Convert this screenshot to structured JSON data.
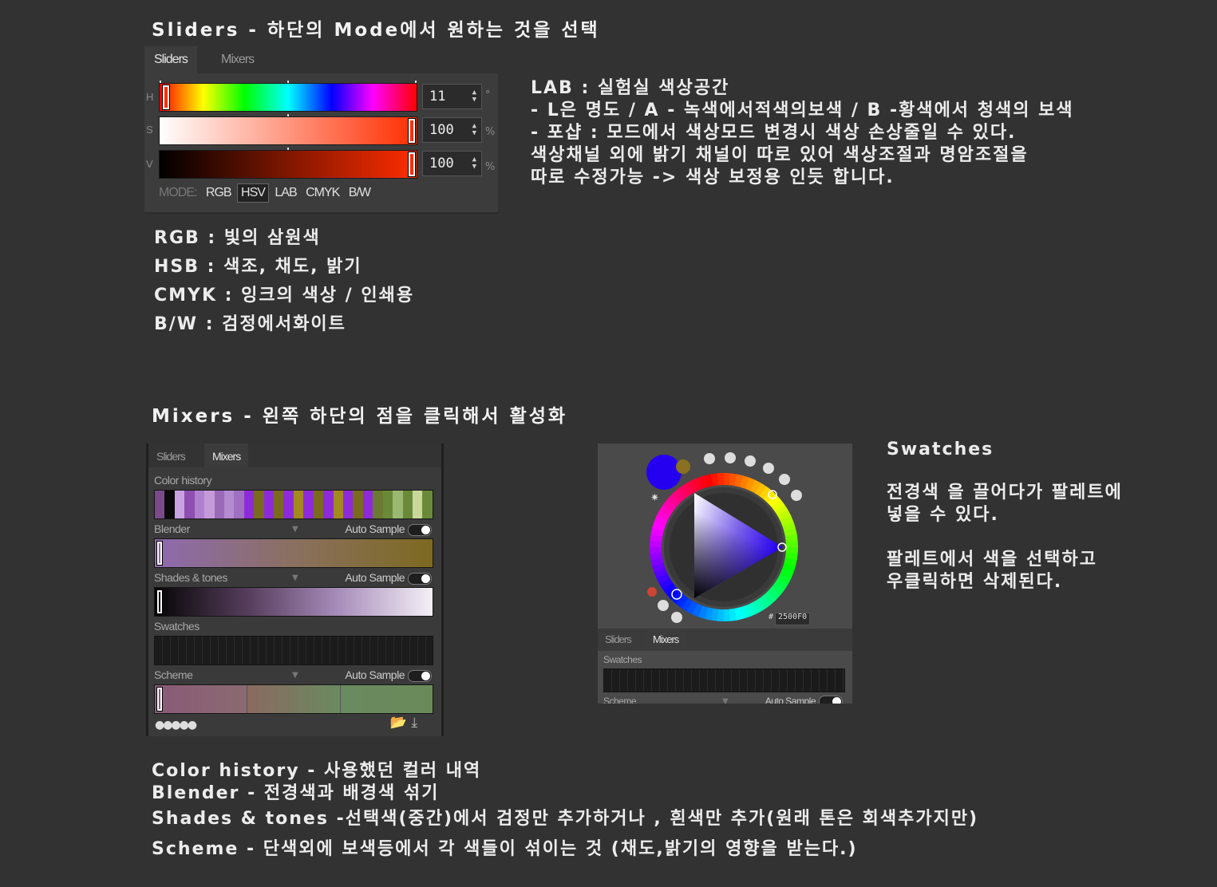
{
  "sliders_section": {
    "heading": "Sliders - 하단의 Mode에서 원하는 것을 선택",
    "panel": {
      "tabs": [
        "Sliders",
        "Mixers"
      ],
      "rows": [
        {
          "label": "H",
          "value": "11",
          "unit": "°"
        },
        {
          "label": "S",
          "value": "100",
          "unit": "%"
        },
        {
          "label": "V",
          "value": "100",
          "unit": "%"
        }
      ],
      "mode_label": "MODE:",
      "modes": [
        "RGB",
        "HSV",
        "LAB",
        "CMYK",
        "B/W"
      ],
      "selected_mode": "HSV",
      "current_color": "#ff2d00"
    },
    "lab_notes": [
      "LAB : 실험실 색상공간",
      "- L은 명도 / A - 녹색에서적색의보색 / B -황색에서 청색의 보색",
      "- 포샵 : 모드에서  색상모드 변경시 색상 손상줄일 수 있다.",
      "색상채널 외에 밝기 채널이 따로 있어 색상조절과 명암조절을",
      "따로 수정가능 -> 색상 보정용 인듯 합니다."
    ],
    "mode_notes": [
      "RGB : 빛의 삼원색",
      "HSB : 색조, 채도, 밝기",
      "CMYK : 잉크의 색상 / 인쇄용",
      "B/W : 검정에서화이트"
    ]
  },
  "mixers_section": {
    "heading": "Mixers - 왼쪽 하단의 점을 클릭해서 활성화",
    "panel": {
      "tabs": [
        "Sliders",
        "Mixers"
      ],
      "active_tab": "Mixers",
      "color_history_label": "Color history",
      "color_history": [
        "#7a4a8a",
        "#0a0a0a",
        "#c9a2e0",
        "#8e4fb0",
        "#b080d0",
        "#c59ad8",
        "#9a6ab8",
        "#b48ad0",
        "#a070c0",
        "#8e2bd8",
        "#7a6a20",
        "#8e2bd8",
        "#7a6a20",
        "#8e2bd8",
        "#a38a20",
        "#8e2bd8",
        "#7a6a20",
        "#8e2bd8",
        "#a38a20",
        "#8e2bd8",
        "#7a6a20",
        "#8e2bd8",
        "#6a7a30",
        "#6a8a3a",
        "#9ab870",
        "#6a8a3a",
        "#c9d89a",
        "#6a8a3a"
      ],
      "blender_label": "Blender",
      "shades_label": "Shades & tones",
      "swatches_label": "Swatches",
      "scheme_label": "Scheme",
      "auto_sample": "Auto Sample",
      "bottom_dots": "●●●●●"
    },
    "wheel_panel": {
      "hex_value": "2500F0",
      "hash": "#",
      "tabs": [
        "Sliders",
        "Mixers"
      ],
      "active_tab": "Mixers",
      "swatches_label": "Swatches",
      "scheme_label": "Scheme",
      "auto_sample": "Auto Sample",
      "foreground_color": "#2500f0"
    },
    "swatches_notes": {
      "title": "Swatches",
      "lines1": [
        "전경색 을 끌어다가 팔레트에",
        "넣을 수 있다."
      ],
      "lines2": [
        "팔레트에서 색을 선택하고",
        "우클릭하면 삭제된다."
      ]
    },
    "bottom_notes": [
      "Color history - 사용했던 컬러 내역",
      "Blender - 전경색과 배경색 섞기",
      "Shades & tones -선택색(중간)에서 검정만 추가하거나 , 흰색만 추가(원래 톤은 회색추가지만)",
      "Scheme - 단색외에 보색등에서 각 색들이 섞이는 것 (채도,밝기의 영향을 받는다.)"
    ]
  }
}
